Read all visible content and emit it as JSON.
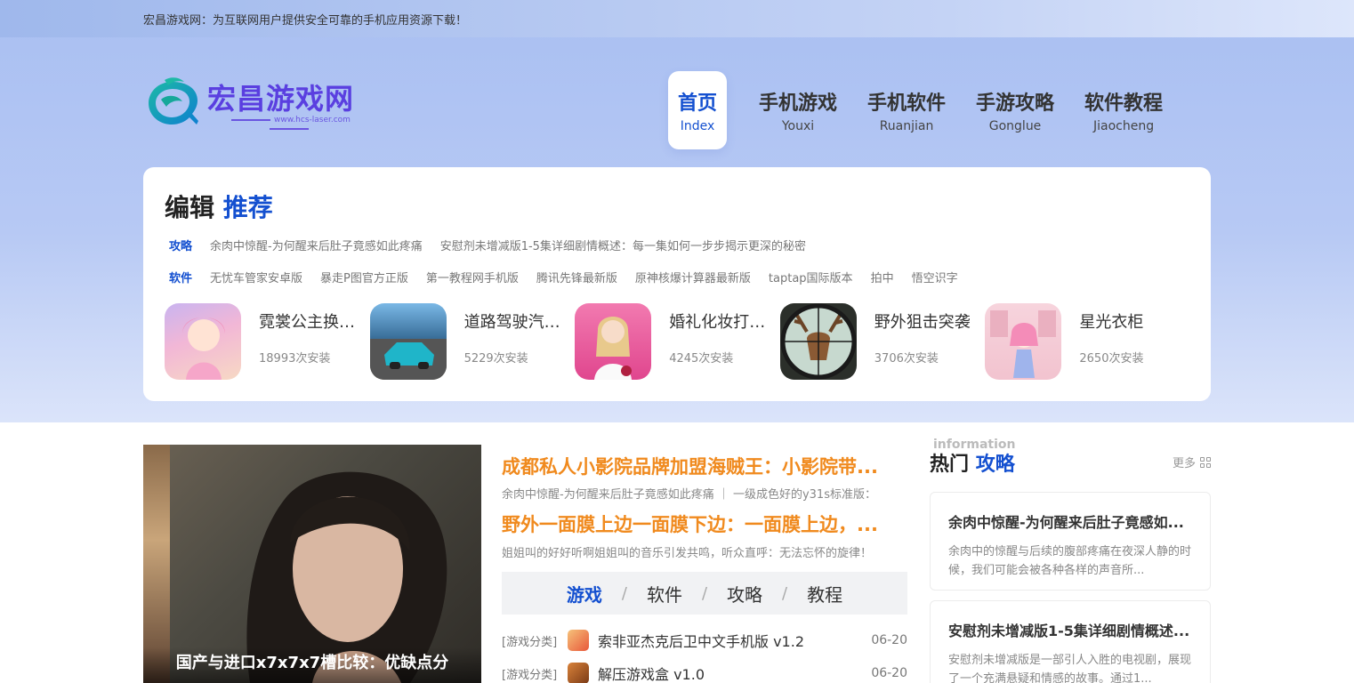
{
  "topbar": {
    "text": "宏昌游戏网：为互联网用户提供安全可靠的手机应用资源下载！"
  },
  "logo": {
    "title": "宏昌游戏网",
    "subtitle": "www.hcs-laser.com",
    "colors": {
      "brand": "#5a3fe0",
      "mark": "#16b3a0"
    }
  },
  "nav": [
    {
      "zh": "首页",
      "en": "Index",
      "active": true
    },
    {
      "zh": "手机游戏",
      "en": "Youxi"
    },
    {
      "zh": "手机软件",
      "en": "Ruanjian"
    },
    {
      "zh": "手游攻略",
      "en": "Gonglue"
    },
    {
      "zh": "软件教程",
      "en": "Jiaocheng"
    }
  ],
  "editor": {
    "title_a": "编辑",
    "title_b": "推荐",
    "guide_tag": "攻略",
    "guides": [
      "余肉中惊醒-为何醒来后肚子竟感如此疼痛",
      "安慰剂未增减版1-5集详细剧情概述：每一集如何一步步揭示更深的秘密"
    ],
    "soft_tag": "软件",
    "softs": [
      "无忧车管家安卓版",
      "暴走P图官方正版",
      "第一教程网手机版",
      "腾讯先锋最新版",
      "原神核爆计算器最新版",
      "taptap国际版本",
      "拍中",
      "悟空识字"
    ],
    "apps": [
      {
        "name": "霓裳公主换装...",
        "installs": "18993次安装"
      },
      {
        "name": "道路驾驶汽车...",
        "installs": "5229次安装"
      },
      {
        "name": "婚礼化妆打扮...",
        "installs": "4245次安装"
      },
      {
        "name": "野外狙击突袭",
        "installs": "3706次安装"
      },
      {
        "name": "星光衣柜",
        "installs": "2650次安装"
      }
    ]
  },
  "feature": {
    "caption": "国产与进口x7x7x7槽比较：优缺点分"
  },
  "headlines": [
    {
      "title": "成都私人小影院品牌加盟海贼王：小影院带...",
      "sub": "余肉中惊醒-为何醒来后肚子竟感如此疼痛 ｜ 一级成色好的y31s标准版："
    },
    {
      "title": "野外一面膜上边一面膜下边：一面膜上边，...",
      "sub": "姐姐叫的好好听啊姐姐叫的音乐引发共鸣，听众直呼：无法忘怀的旋律！"
    }
  ],
  "tabs": {
    "t1": "游戏",
    "t2": "软件",
    "t3": "攻略",
    "t4": "教程",
    "sep": "/"
  },
  "list": [
    {
      "cat": "[游戏分类]",
      "title": "索非亚杰克后卫中文手机版 v1.2",
      "date": "06-20"
    },
    {
      "cat": "[游戏分类]",
      "title": "解压游戏盒 v1.0",
      "date": "06-20"
    }
  ],
  "side": {
    "ghost": "information",
    "title_a": "热门",
    "title_b": "攻略",
    "more": "更多",
    "cards": [
      {
        "title": "余肉中惊醒-为何醒来后肚子竟感如...",
        "desc": "余肉中的惊醒与后续的腹部疼痛在夜深人静的时候，我们可能会被各种各样的声音所..."
      },
      {
        "title": "安慰剂未增减版1-5集详细剧情概述...",
        "desc": "安慰剂未增减版是一部引人入胜的电视剧，展现了一个充满悬疑和情感的故事。通过1..."
      }
    ]
  }
}
